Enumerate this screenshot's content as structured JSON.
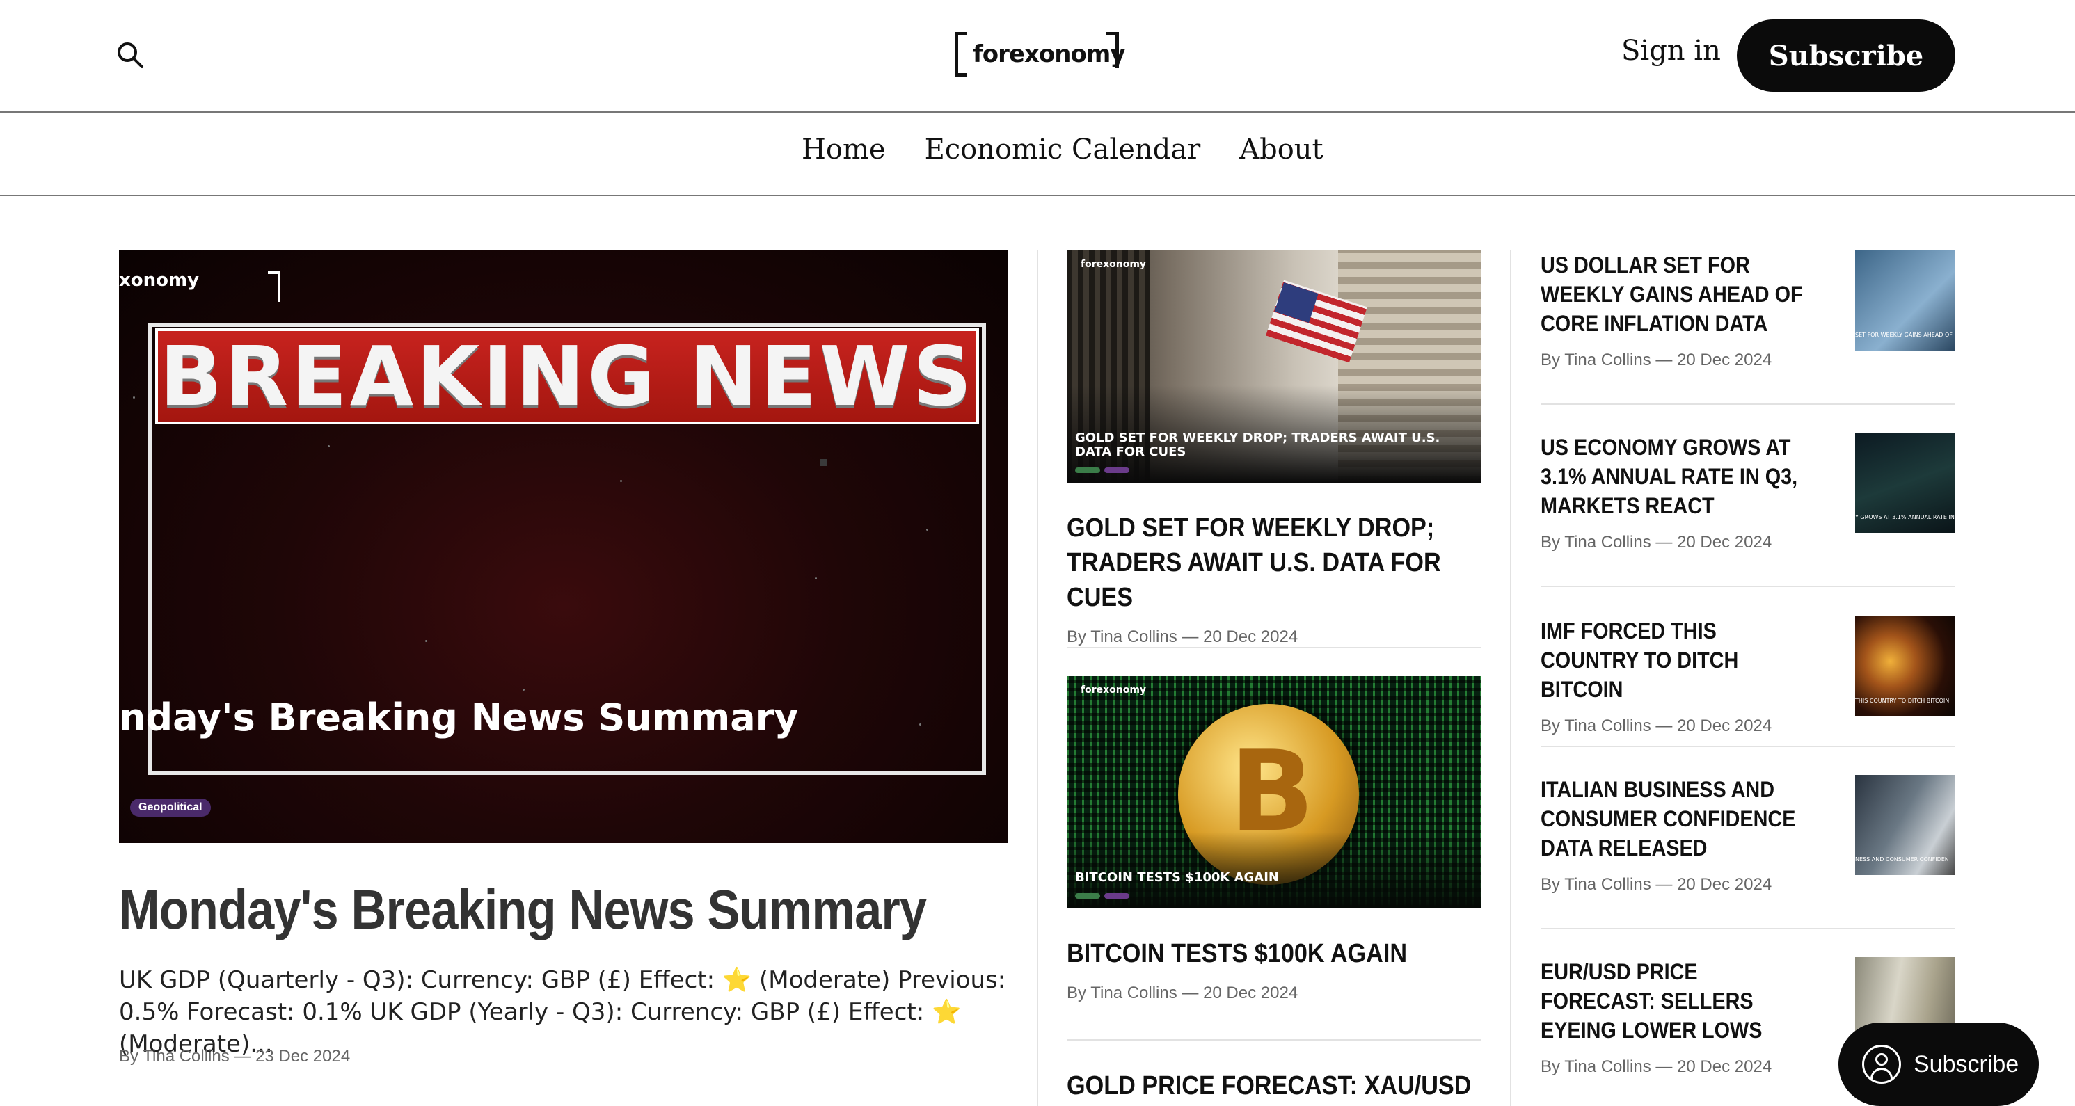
{
  "header": {
    "logo_text": "forexonomy",
    "signin_label": "Sign in",
    "subscribe_label": "Subscribe"
  },
  "nav": {
    "items": [
      {
        "label": "Home"
      },
      {
        "label": "Economic Calendar"
      },
      {
        "label": "About"
      }
    ]
  },
  "featured": {
    "image": {
      "logo_text": "xonomy",
      "banner_text": "BREAKING NEWS",
      "caption": "nday's Breaking News Summary",
      "tag": "Geopolitical"
    },
    "title": "Monday's Breaking News Summary",
    "excerpt": "UK GDP (Quarterly - Q3): Currency: GBP (£) Effect: ⭐ (Moderate) Previous: 0.5% Forecast: 0.1% UK GDP (Yearly - Q3): Currency: GBP (£) Effect: ⭐ (Moderate)...",
    "meta": "By Tina Collins — 23 Dec 2024"
  },
  "middle": [
    {
      "image_logo": "forexonomy",
      "image_caption": "GOLD SET FOR WEEKLY DROP; TRADERS AWAIT U.S. DATA FOR CUES",
      "title": "GOLD SET FOR WEEKLY DROP; TRADERS AWAIT U.S. DATA FOR CUES",
      "meta": "By Tina Collins — 20 Dec 2024"
    },
    {
      "image_logo": "forexonomy",
      "image_caption": "BITCOIN TESTS $100K AGAIN",
      "title": "BITCOIN TESTS $100K AGAIN",
      "meta": "By Tina Collins — 20 Dec 2024"
    },
    {
      "title": "GOLD PRICE FORECAST: XAU/USD"
    }
  ],
  "side": [
    {
      "title": "US DOLLAR SET FOR WEEKLY GAINS AHEAD OF CORE INFLATION DATA",
      "meta": "By Tina Collins — 20 Dec 2024",
      "thumb_caption": "SET FOR WEEKLY GAINS AHEAD OF CO"
    },
    {
      "title": "US ECONOMY GROWS AT 3.1% ANNUAL RATE IN Q3, MARKETS REACT",
      "meta": "By Tina Collins — 20 Dec 2024",
      "thumb_caption": "Y GROWS AT 3.1% ANNUAL RATE IN"
    },
    {
      "title": "IMF FORCED THIS COUNTRY TO DITCH BITCOIN",
      "meta": "By Tina Collins — 20 Dec 2024",
      "thumb_caption": "THIS COUNTRY TO DITCH BITCOIN"
    },
    {
      "title": "ITALIAN BUSINESS AND CONSUMER CONFIDENCE DATA RELEASED",
      "meta": "By Tina Collins — 20 Dec 2024",
      "thumb_caption": "NESS AND CONSUMER CONFIDEN"
    },
    {
      "title": "EUR/USD PRICE FORECAST: SELLERS EYEING LOWER LOWS",
      "meta": "By Tina Collins — 20 Dec 2024",
      "thumb_caption": ""
    }
  ],
  "floating_subscribe": {
    "label": "Subscribe"
  }
}
